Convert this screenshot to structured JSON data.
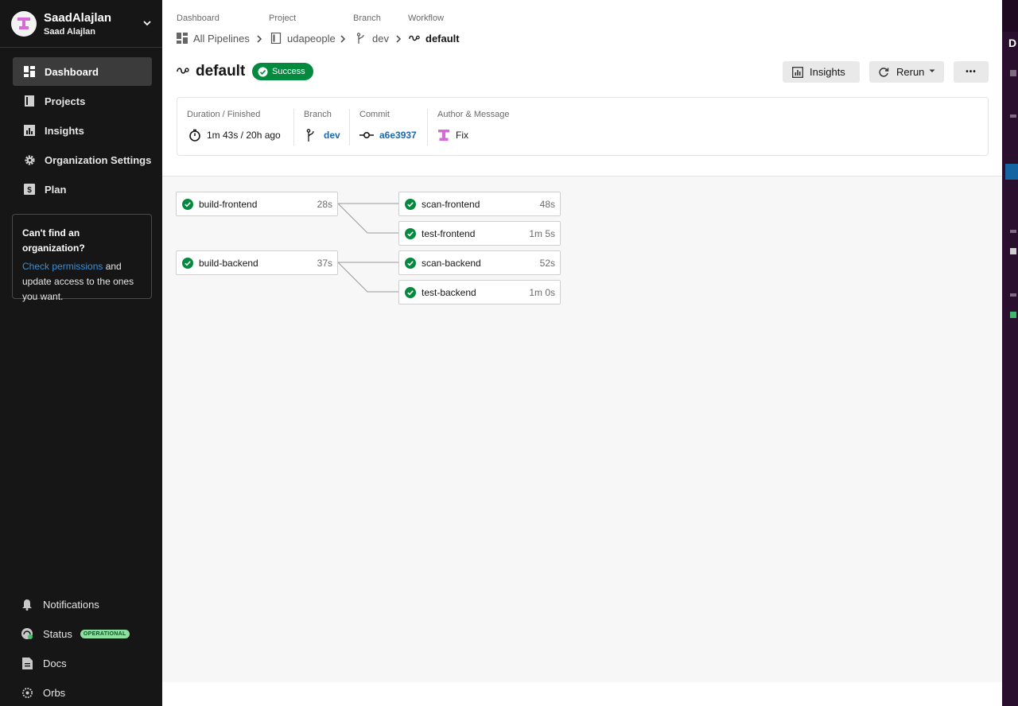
{
  "user": {
    "name": "SaadAlajlan",
    "subname": "Saad Alajlan"
  },
  "sidebar": {
    "items": [
      {
        "label": "Dashboard",
        "icon": "dashboard-icon",
        "active": true
      },
      {
        "label": "Projects",
        "icon": "projects-icon"
      },
      {
        "label": "Insights",
        "icon": "insights-icon"
      },
      {
        "label": "Organization Settings",
        "icon": "gear-icon"
      },
      {
        "label": "Plan",
        "icon": "plan-icon"
      }
    ],
    "org_card": {
      "title": "Can't find an organization?",
      "link": "Check permissions",
      "text_after_link": " and update access to the ones you want."
    },
    "bottom": {
      "notifications": "Notifications",
      "status": "Status",
      "status_badge": "OPERATIONAL",
      "docs": "Docs",
      "orbs": "Orbs"
    }
  },
  "breadcrumb": {
    "labels": {
      "dashboard": "Dashboard",
      "project": "Project",
      "branch": "Branch",
      "workflow": "Workflow"
    },
    "values": {
      "dashboard": "All Pipelines",
      "project": "udapeople",
      "branch": "dev",
      "workflow": "default"
    }
  },
  "workflow": {
    "title": "default",
    "status": "Success",
    "buttons": {
      "insights": "Insights",
      "rerun": "Rerun",
      "more": "•••"
    }
  },
  "info": {
    "duration_label": "Duration / Finished",
    "duration_value": "1m 43s / 20h ago",
    "branch_label": "Branch",
    "branch_value": "dev",
    "commit_label": "Commit",
    "commit_value": "a6e3937",
    "author_label": "Author & Message",
    "author_message": "Fix"
  },
  "jobs": [
    {
      "name": "build-frontend",
      "duration": "28s"
    },
    {
      "name": "scan-frontend",
      "duration": "48s"
    },
    {
      "name": "test-frontend",
      "duration": "1m 5s"
    },
    {
      "name": "build-backend",
      "duration": "37s"
    },
    {
      "name": "scan-backend",
      "duration": "52s"
    },
    {
      "name": "test-backend",
      "duration": "1m 0s"
    }
  ],
  "colors": {
    "success": "#038a3e",
    "link": "#1c67b1",
    "sidebar_bg": "#161616",
    "accent_pink": "#d66ad6"
  },
  "strip": {
    "letter": "D"
  }
}
